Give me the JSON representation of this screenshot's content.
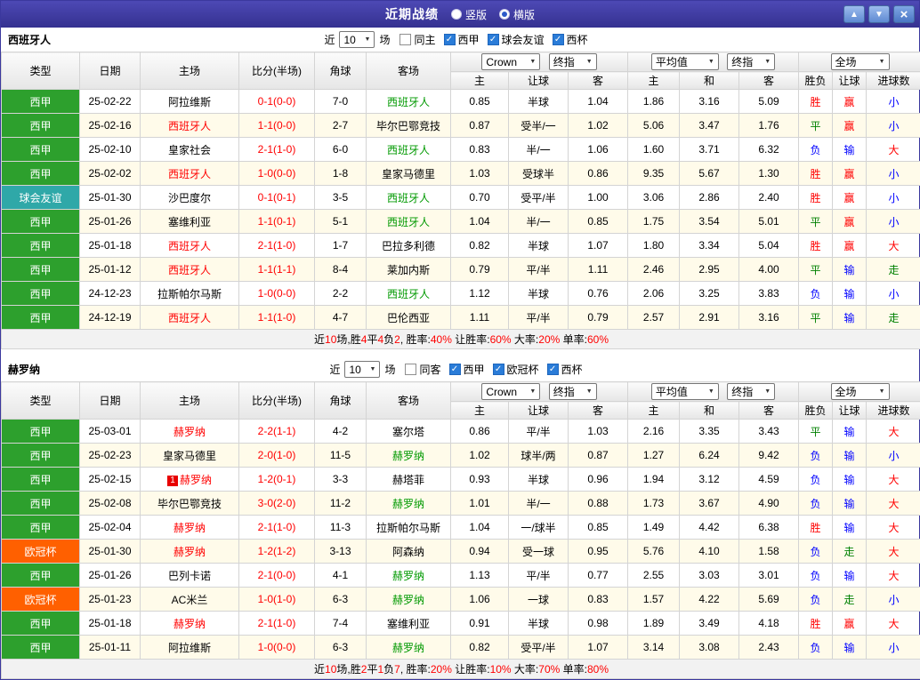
{
  "titlebar": {
    "title": "近期战绩",
    "radios": [
      {
        "label": "竖版",
        "selected": false
      },
      {
        "label": "横版",
        "selected": true
      }
    ],
    "up_icon": "▲",
    "down_icon": "▼",
    "close_icon": "×"
  },
  "icons": {
    "chevron_down": "▼",
    "check": "✓"
  },
  "filter": {
    "near_label": "近",
    "games_label": "场"
  },
  "columns": {
    "type": "类型",
    "date": "日期",
    "home": "主场",
    "score": "比分(半场)",
    "corners": "角球",
    "away": "客场",
    "bookmaker_select": "Crown",
    "asian_final_select": "终指",
    "euro_avg_select": "平均值",
    "euro_final_select": "终指",
    "scope_select": "全场",
    "sub": [
      "主",
      "让球",
      "客",
      "主",
      "和",
      "客",
      "胜负",
      "让球",
      "进球数"
    ]
  },
  "type_colors": {
    "西甲": "#2da02d",
    "球会友谊": "#2fa8a8",
    "欧冠杯": "#ff6000"
  },
  "result_colors": {
    "胜": "#ff0000",
    "赢": "#ff0000",
    "大": "#ff0000",
    "平": "#008000",
    "走": "#008000",
    "负": "#0000ff",
    "输": "#0000ff",
    "小": "#0000ff"
  },
  "accent_colors": {
    "self_home": "#ff0000",
    "self_away": "#009900",
    "score": "#ff0000",
    "summary_number": "#ff0000",
    "titlebar_bg": "#403c9f",
    "checkbox_on": "#2a7cd8"
  },
  "sections": [
    {
      "team": "西班牙人",
      "near_value": "10",
      "checkboxes": [
        {
          "label": "同主",
          "checked": false
        },
        {
          "label": "西甲",
          "checked": true
        },
        {
          "label": "球会友谊",
          "checked": true
        },
        {
          "label": "西杯",
          "checked": true
        }
      ],
      "rows": [
        {
          "type": "西甲",
          "date": "25-02-22",
          "home": "阿拉维斯",
          "score": "0-1(0-0)",
          "corners": "7-0",
          "away": "西班牙人",
          "self_side": "away",
          "asian_home": "0.85",
          "handicap": "半球",
          "asian_away": "1.04",
          "euro_home": "1.86",
          "euro_draw": "3.16",
          "euro_away": "5.09",
          "result": "胜",
          "handicap_result": "赢",
          "goals_result": "小"
        },
        {
          "type": "西甲",
          "date": "25-02-16",
          "home": "西班牙人",
          "score": "1-1(0-0)",
          "corners": "2-7",
          "away": "毕尔巴鄂竞技",
          "self_side": "home",
          "asian_home": "0.87",
          "handicap": "受半/一",
          "asian_away": "1.02",
          "euro_home": "5.06",
          "euro_draw": "3.47",
          "euro_away": "1.76",
          "result": "平",
          "handicap_result": "赢",
          "goals_result": "小"
        },
        {
          "type": "西甲",
          "date": "25-02-10",
          "home": "皇家社会",
          "score": "2-1(1-0)",
          "corners": "6-0",
          "away": "西班牙人",
          "self_side": "away",
          "asian_home": "0.83",
          "handicap": "半/一",
          "asian_away": "1.06",
          "euro_home": "1.60",
          "euro_draw": "3.71",
          "euro_away": "6.32",
          "result": "负",
          "handicap_result": "输",
          "goals_result": "大"
        },
        {
          "type": "西甲",
          "date": "25-02-02",
          "home": "西班牙人",
          "score": "1-0(0-0)",
          "corners": "1-8",
          "away": "皇家马德里",
          "self_side": "home",
          "asian_home": "1.03",
          "handicap": "受球半",
          "asian_away": "0.86",
          "euro_home": "9.35",
          "euro_draw": "5.67",
          "euro_away": "1.30",
          "result": "胜",
          "handicap_result": "赢",
          "goals_result": "小"
        },
        {
          "type": "球会友谊",
          "date": "25-01-30",
          "home": "沙巴度尔",
          "score": "0-1(0-1)",
          "corners": "3-5",
          "away": "西班牙人",
          "self_side": "away",
          "asian_home": "0.70",
          "handicap": "受平/半",
          "asian_away": "1.00",
          "euro_home": "3.06",
          "euro_draw": "2.86",
          "euro_away": "2.40",
          "result": "胜",
          "handicap_result": "赢",
          "goals_result": "小"
        },
        {
          "type": "西甲",
          "date": "25-01-26",
          "home": "塞维利亚",
          "score": "1-1(0-1)",
          "corners": "5-1",
          "away": "西班牙人",
          "self_side": "away",
          "asian_home": "1.04",
          "handicap": "半/一",
          "asian_away": "0.85",
          "euro_home": "1.75",
          "euro_draw": "3.54",
          "euro_away": "5.01",
          "result": "平",
          "handicap_result": "赢",
          "goals_result": "小"
        },
        {
          "type": "西甲",
          "date": "25-01-18",
          "home": "西班牙人",
          "score": "2-1(1-0)",
          "corners": "1-7",
          "away": "巴拉多利德",
          "self_side": "home",
          "asian_home": "0.82",
          "handicap": "半球",
          "asian_away": "1.07",
          "euro_home": "1.80",
          "euro_draw": "3.34",
          "euro_away": "5.04",
          "result": "胜",
          "handicap_result": "赢",
          "goals_result": "大"
        },
        {
          "type": "西甲",
          "date": "25-01-12",
          "home": "西班牙人",
          "score": "1-1(1-1)",
          "corners": "8-4",
          "away": "莱加内斯",
          "self_side": "home",
          "asian_home": "0.79",
          "handicap": "平/半",
          "asian_away": "1.11",
          "euro_home": "2.46",
          "euro_draw": "2.95",
          "euro_away": "4.00",
          "result": "平",
          "handicap_result": "输",
          "goals_result": "走"
        },
        {
          "type": "西甲",
          "date": "24-12-23",
          "home": "拉斯帕尔马斯",
          "score": "1-0(0-0)",
          "corners": "2-2",
          "away": "西班牙人",
          "self_side": "away",
          "asian_home": "1.12",
          "handicap": "半球",
          "asian_away": "0.76",
          "euro_home": "2.06",
          "euro_draw": "3.25",
          "euro_away": "3.83",
          "result": "负",
          "handicap_result": "输",
          "goals_result": "小"
        },
        {
          "type": "西甲",
          "date": "24-12-19",
          "home": "西班牙人",
          "score": "1-1(1-0)",
          "corners": "4-7",
          "away": "巴伦西亚",
          "self_side": "home",
          "asian_home": "1.11",
          "handicap": "平/半",
          "asian_away": "0.79",
          "euro_home": "2.57",
          "euro_draw": "2.91",
          "euro_away": "3.16",
          "result": "平",
          "handicap_result": "输",
          "goals_result": "走"
        }
      ],
      "summary_parts": [
        {
          "t": "近"
        },
        {
          "t": "10",
          "red": true
        },
        {
          "t": "场,胜"
        },
        {
          "t": "4",
          "red": true
        },
        {
          "t": "平"
        },
        {
          "t": "4",
          "red": true
        },
        {
          "t": "负"
        },
        {
          "t": "2",
          "red": true
        },
        {
          "t": ", 胜率:"
        },
        {
          "t": "40%",
          "red": true
        },
        {
          "t": " 让胜率:"
        },
        {
          "t": "60%",
          "red": true
        },
        {
          "t": " 大率:"
        },
        {
          "t": "20%",
          "red": true
        },
        {
          "t": " 单率:"
        },
        {
          "t": "60%",
          "red": true
        }
      ]
    },
    {
      "team": "赫罗纳",
      "near_value": "10",
      "checkboxes": [
        {
          "label": "同客",
          "checked": false
        },
        {
          "label": "西甲",
          "checked": true
        },
        {
          "label": "欧冠杯",
          "checked": true
        },
        {
          "label": "西杯",
          "checked": true
        }
      ],
      "rows": [
        {
          "type": "西甲",
          "date": "25-03-01",
          "home": "赫罗纳",
          "score": "2-2(1-1)",
          "corners": "4-2",
          "away": "塞尔塔",
          "self_side": "home",
          "asian_home": "0.86",
          "handicap": "平/半",
          "asian_away": "1.03",
          "euro_home": "2.16",
          "euro_draw": "3.35",
          "euro_away": "3.43",
          "result": "平",
          "handicap_result": "输",
          "goals_result": "大"
        },
        {
          "type": "西甲",
          "date": "25-02-23",
          "home": "皇家马德里",
          "score": "2-0(1-0)",
          "corners": "11-5",
          "away": "赫罗纳",
          "self_side": "away",
          "asian_home": "1.02",
          "handicap": "球半/两",
          "asian_away": "0.87",
          "euro_home": "1.27",
          "euro_draw": "6.24",
          "euro_away": "9.42",
          "result": "负",
          "handicap_result": "输",
          "goals_result": "小"
        },
        {
          "type": "西甲",
          "date": "25-02-15",
          "home": "赫罗纳",
          "badge": "1",
          "score": "1-2(0-1)",
          "corners": "3-3",
          "away": "赫塔菲",
          "self_side": "home",
          "asian_home": "0.93",
          "handicap": "半球",
          "asian_away": "0.96",
          "euro_home": "1.94",
          "euro_draw": "3.12",
          "euro_away": "4.59",
          "result": "负",
          "handicap_result": "输",
          "goals_result": "大"
        },
        {
          "type": "西甲",
          "date": "25-02-08",
          "home": "毕尔巴鄂竞技",
          "score": "3-0(2-0)",
          "corners": "11-2",
          "away": "赫罗纳",
          "self_side": "away",
          "asian_home": "1.01",
          "handicap": "半/一",
          "asian_away": "0.88",
          "euro_home": "1.73",
          "euro_draw": "3.67",
          "euro_away": "4.90",
          "result": "负",
          "handicap_result": "输",
          "goals_result": "大"
        },
        {
          "type": "西甲",
          "date": "25-02-04",
          "home": "赫罗纳",
          "score": "2-1(1-0)",
          "corners": "11-3",
          "away": "拉斯帕尔马斯",
          "self_side": "home",
          "asian_home": "1.04",
          "handicap": "一/球半",
          "asian_away": "0.85",
          "euro_home": "1.49",
          "euro_draw": "4.42",
          "euro_away": "6.38",
          "result": "胜",
          "handicap_result": "输",
          "goals_result": "大"
        },
        {
          "type": "欧冠杯",
          "date": "25-01-30",
          "home": "赫罗纳",
          "score": "1-2(1-2)",
          "corners": "3-13",
          "away": "阿森纳",
          "self_side": "home",
          "asian_home": "0.94",
          "handicap": "受一球",
          "asian_away": "0.95",
          "euro_home": "5.76",
          "euro_draw": "4.10",
          "euro_away": "1.58",
          "result": "负",
          "handicap_result": "走",
          "goals_result": "大"
        },
        {
          "type": "西甲",
          "date": "25-01-26",
          "home": "巴列卡诺",
          "score": "2-1(0-0)",
          "corners": "4-1",
          "away": "赫罗纳",
          "self_side": "away",
          "asian_home": "1.13",
          "handicap": "平/半",
          "asian_away": "0.77",
          "euro_home": "2.55",
          "euro_draw": "3.03",
          "euro_away": "3.01",
          "result": "负",
          "handicap_result": "输",
          "goals_result": "大"
        },
        {
          "type": "欧冠杯",
          "date": "25-01-23",
          "home": "AC米兰",
          "score": "1-0(1-0)",
          "corners": "6-3",
          "away": "赫罗纳",
          "self_side": "away",
          "asian_home": "1.06",
          "handicap": "一球",
          "asian_away": "0.83",
          "euro_home": "1.57",
          "euro_draw": "4.22",
          "euro_away": "5.69",
          "result": "负",
          "handicap_result": "走",
          "goals_result": "小"
        },
        {
          "type": "西甲",
          "date": "25-01-18",
          "home": "赫罗纳",
          "score": "2-1(1-0)",
          "corners": "7-4",
          "away": "塞维利亚",
          "self_side": "home",
          "asian_home": "0.91",
          "handicap": "半球",
          "asian_away": "0.98",
          "euro_home": "1.89",
          "euro_draw": "3.49",
          "euro_away": "4.18",
          "result": "胜",
          "handicap_result": "赢",
          "goals_result": "大"
        },
        {
          "type": "西甲",
          "date": "25-01-11",
          "home": "阿拉维斯",
          "score": "1-0(0-0)",
          "corners": "6-3",
          "away": "赫罗纳",
          "self_side": "away",
          "asian_home": "0.82",
          "handicap": "受平/半",
          "asian_away": "1.07",
          "euro_home": "3.14",
          "euro_draw": "3.08",
          "euro_away": "2.43",
          "result": "负",
          "handicap_result": "输",
          "goals_result": "小"
        }
      ],
      "summary_parts": [
        {
          "t": "近"
        },
        {
          "t": "10",
          "red": true
        },
        {
          "t": "场,胜"
        },
        {
          "t": "2",
          "red": true
        },
        {
          "t": "平"
        },
        {
          "t": "1",
          "red": true
        },
        {
          "t": "负"
        },
        {
          "t": "7",
          "red": true
        },
        {
          "t": ", 胜率:"
        },
        {
          "t": "20%",
          "red": true
        },
        {
          "t": " 让胜率:"
        },
        {
          "t": "10%",
          "red": true
        },
        {
          "t": " 大率:"
        },
        {
          "t": "70%",
          "red": true
        },
        {
          "t": " 单率:"
        },
        {
          "t": "80%",
          "red": true
        }
      ]
    }
  ]
}
